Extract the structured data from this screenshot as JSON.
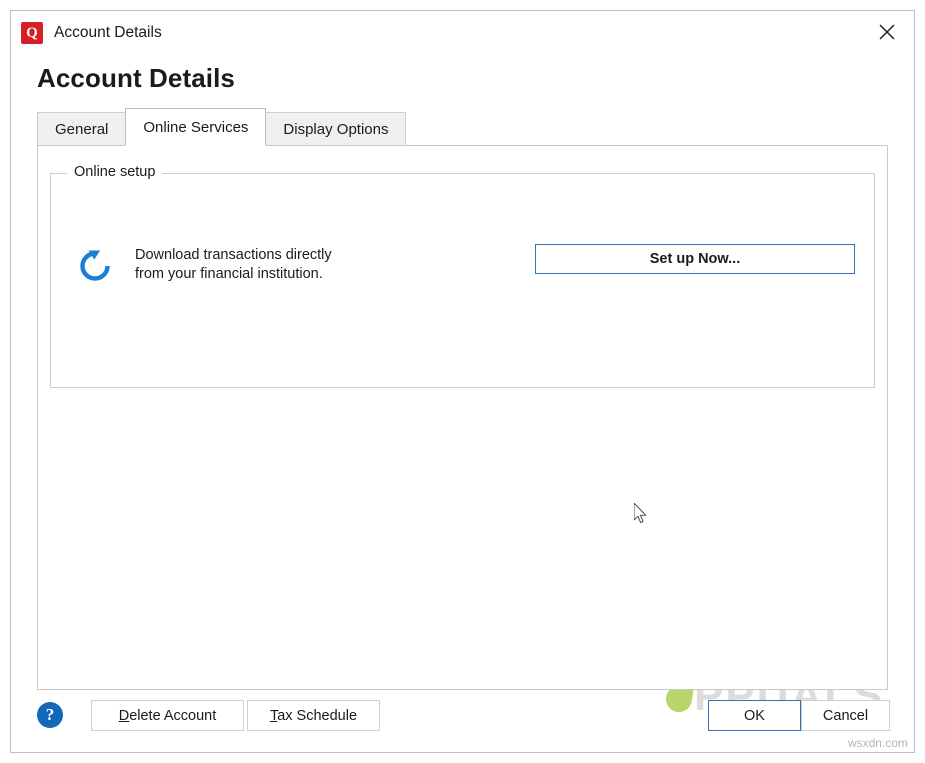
{
  "window": {
    "title": "Account Details",
    "app_icon": "quicken-q-icon",
    "close_icon": "close-icon"
  },
  "page_title": "Account Details",
  "tabs": [
    {
      "label": "General",
      "active": false
    },
    {
      "label": "Online Services",
      "active": true
    },
    {
      "label": "Display Options",
      "active": false
    }
  ],
  "panel": {
    "group_legend": "Online setup",
    "refresh_icon": "refresh-circular-arrow-icon",
    "description": "Download transactions directly from your financial institution.",
    "setup_button": "Set up Now..."
  },
  "watermark": {
    "text": "PPUALS",
    "source": "wsxdn.com"
  },
  "footer": {
    "help_icon": "help-question-icon",
    "delete_account": "Delete Account",
    "delete_account_accel": "D",
    "tax_schedule": "Tax Schedule",
    "tax_schedule_accel": "T",
    "ok": "OK",
    "cancel": "Cancel"
  },
  "colors": {
    "accent": "#2f72b8",
    "app_icon": "#d62026",
    "help": "#1368ba",
    "refresh": "#1a7fd4"
  }
}
